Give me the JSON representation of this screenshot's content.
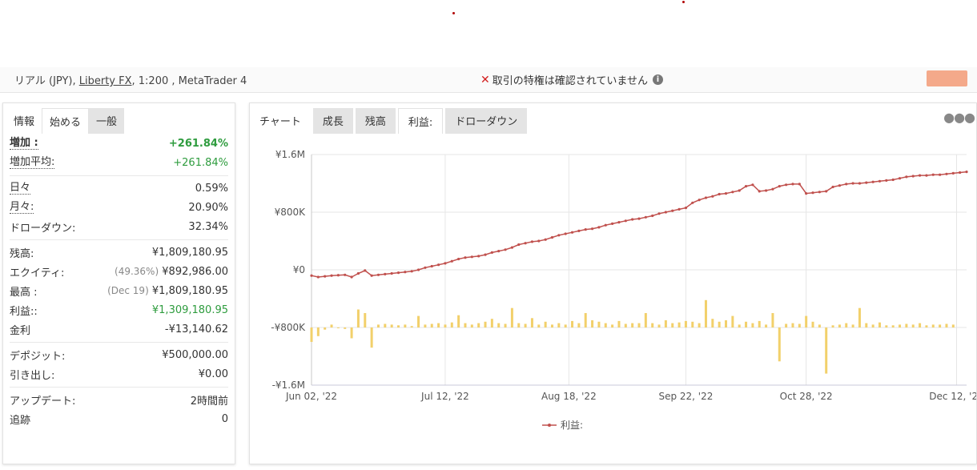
{
  "account": {
    "prefix": "リアル (JPY), ",
    "broker": "Liberty FX",
    "suffix": ", 1:200 , MetaTrader 4"
  },
  "notice": {
    "text": "取引の特権は確認されていません"
  },
  "left_tabs": [
    "情報",
    "始める",
    "一般"
  ],
  "stats": {
    "gain_label": "増加 :",
    "gain_value": "+261.84%",
    "avg_gain_label": "増加平均:",
    "avg_gain_value": "+261.84%",
    "daily_label": "日々",
    "daily_value": "0.59%",
    "monthly_label": "月々:",
    "monthly_value": "20.90%",
    "drawdown_label": "ドローダウン:",
    "drawdown_value": "32.34%",
    "balance_label": "残高:",
    "balance_value": "¥1,809,180.95",
    "equity_label": "エクイティ:",
    "equity_pct": "(49.36%)",
    "equity_value": "¥892,986.00",
    "highest_label": "最高 :",
    "highest_date": "(Dec 19)",
    "highest_value": "¥1,809,180.95",
    "profit_label": "利益::",
    "profit_value": "¥1,309,180.95",
    "interest_label": "金利",
    "interest_value": "-¥13,140.62",
    "deposit_label": "デポジット:",
    "deposit_value": "¥500,000.00",
    "withdrawal_label": "引き出し:",
    "withdrawal_value": "¥0.00",
    "update_label": "アップデート:",
    "update_value": "2時間前",
    "tracking_label": "追跡",
    "tracking_value": "0"
  },
  "right_tabs": [
    "チャート",
    "成長",
    "残高",
    "利益:",
    "ドローダウン"
  ],
  "colors": {
    "line": "#c0504d",
    "bar": "#f2d06b",
    "green": "#2e9c3e",
    "accent": "#f4a98a"
  },
  "chart_data": {
    "type": "line",
    "ylim": [
      -1600000,
      1600000
    ],
    "y_ticks": [
      "¥1.6M",
      "¥800K",
      "¥0",
      "-¥800K",
      "-¥1.6M"
    ],
    "y_tick_values": [
      1600000,
      800000,
      0,
      -800000,
      -1600000
    ],
    "x_ticks": [
      "Jun 02, '22",
      "Jul 12, '22",
      "Aug 18, '22",
      "Sep 22, '22",
      "Oct 28, '22",
      "Dec 12, '22"
    ],
    "x_tick_values": [
      0,
      40,
      77,
      112,
      148,
      193
    ],
    "legend": "利益:",
    "series": [
      {
        "name": "利益:",
        "x": [
          0,
          2,
          4,
          6,
          8,
          10,
          12,
          14,
          16,
          18,
          20,
          22,
          24,
          26,
          28,
          30,
          32,
          34,
          36,
          38,
          40,
          42,
          44,
          46,
          48,
          50,
          52,
          54,
          56,
          58,
          60,
          62,
          64,
          66,
          68,
          70,
          72,
          74,
          76,
          78,
          80,
          82,
          84,
          86,
          88,
          90,
          92,
          94,
          96,
          98,
          100,
          102,
          104,
          106,
          108,
          110,
          112,
          114,
          116,
          118,
          120,
          122,
          124,
          126,
          128,
          130,
          132,
          134,
          136,
          138,
          140,
          142,
          144,
          146,
          148,
          150,
          152,
          154,
          156,
          158,
          160,
          162,
          164,
          166,
          168,
          170,
          172,
          174,
          176,
          178,
          180,
          182,
          184,
          186,
          188,
          190,
          192,
          194,
          196
        ],
        "values": [
          -80000,
          -100000,
          -90000,
          -80000,
          -75000,
          -70000,
          -100000,
          -50000,
          -10000,
          -80000,
          -70000,
          -60000,
          -50000,
          -40000,
          -30000,
          -20000,
          0,
          30000,
          50000,
          70000,
          90000,
          120000,
          150000,
          170000,
          180000,
          190000,
          210000,
          240000,
          260000,
          280000,
          310000,
          350000,
          370000,
          390000,
          400000,
          420000,
          450000,
          480000,
          500000,
          520000,
          540000,
          560000,
          570000,
          590000,
          620000,
          640000,
          660000,
          680000,
          700000,
          710000,
          730000,
          750000,
          780000,
          800000,
          820000,
          840000,
          860000,
          930000,
          970000,
          1000000,
          1020000,
          1050000,
          1060000,
          1080000,
          1100000,
          1160000,
          1180000,
          1090000,
          1100000,
          1120000,
          1160000,
          1180000,
          1190000,
          1190000,
          1060000,
          1070000,
          1080000,
          1090000,
          1150000,
          1170000,
          1190000,
          1200000,
          1200000,
          1210000,
          1220000,
          1230000,
          1240000,
          1250000,
          1270000,
          1290000,
          1300000,
          1310000,
          1310000,
          1320000,
          1320000,
          1330000,
          1340000,
          1350000,
          1360000
        ]
      },
      {
        "name": "bars",
        "type": "bar",
        "x": [
          0,
          1,
          2,
          3,
          4,
          5,
          6,
          7,
          8,
          9,
          10,
          11,
          12,
          13,
          14,
          15,
          16,
          17,
          18,
          19,
          20,
          21,
          22,
          23,
          24,
          25,
          26,
          27,
          28,
          29,
          30,
          31,
          32,
          33,
          34,
          35,
          36,
          37,
          38,
          39,
          40,
          41,
          42,
          43,
          44,
          45,
          46,
          47,
          48,
          49,
          50,
          51,
          52,
          53,
          54,
          55,
          56,
          57,
          58,
          59,
          60,
          61,
          62,
          63,
          64,
          65,
          66,
          67,
          68,
          69,
          70,
          71,
          72,
          73,
          74,
          75,
          76,
          77,
          78,
          79,
          80,
          81,
          82,
          83,
          84,
          85,
          86,
          87,
          88,
          89,
          90,
          91,
          92,
          93,
          94,
          95,
          96
        ],
        "values": [
          -200000,
          -120000,
          -30000,
          40000,
          0,
          -20000,
          -150000,
          250000,
          200000,
          -280000,
          40000,
          50000,
          40000,
          30000,
          40000,
          20000,
          160000,
          40000,
          50000,
          60000,
          40000,
          70000,
          170000,
          60000,
          40000,
          60000,
          80000,
          120000,
          60000,
          50000,
          270000,
          60000,
          50000,
          130000,
          40000,
          80000,
          40000,
          60000,
          40000,
          90000,
          60000,
          200000,
          100000,
          80000,
          60000,
          40000,
          90000,
          50000,
          60000,
          60000,
          200000,
          60000,
          40000,
          100000,
          60000,
          70000,
          90000,
          80000,
          60000,
          380000,
          120000,
          80000,
          100000,
          160000,
          40000,
          80000,
          60000,
          90000,
          40000,
          200000,
          -470000,
          50000,
          60000,
          50000,
          160000,
          80000,
          40000,
          -640000,
          30000,
          40000,
          60000,
          40000,
          270000,
          60000,
          40000,
          70000,
          30000,
          30000,
          40000,
          50000,
          40000,
          60000,
          30000,
          40000,
          40000,
          50000,
          40000
        ]
      }
    ]
  }
}
